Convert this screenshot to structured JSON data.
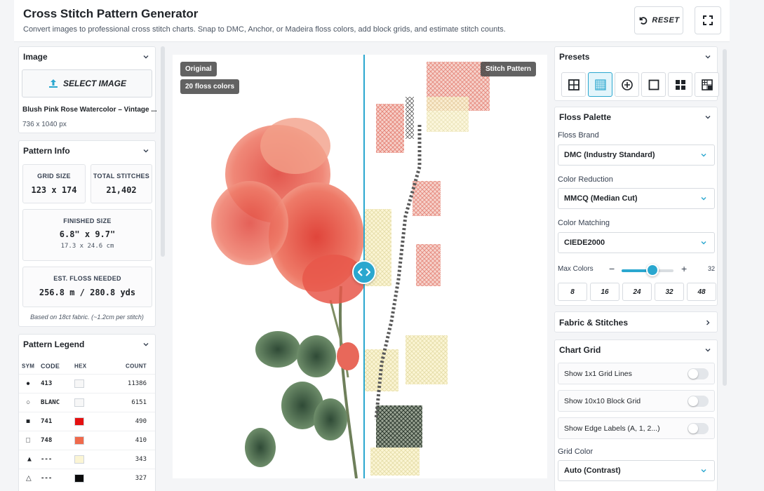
{
  "header": {
    "title": "Cross Stitch Pattern Generator",
    "subtitle": "Convert images to professional cross stitch charts. Snap to DMC, Anchor, or Madeira floss colors, add block grids, and estimate stitch counts.",
    "reset_label": "RESET",
    "fullscreen_icon": "expand-icon"
  },
  "image_panel": {
    "title": "Image",
    "select_label": "SELECT IMAGE",
    "file_name": "Blush Pink Rose Watercolor – Vintage ...",
    "dimensions": "736 x 1040 px"
  },
  "pattern_info": {
    "title": "Pattern Info",
    "grid_size_label": "GRID SIZE",
    "grid_size_value": "123 x 174",
    "total_stitches_label": "TOTAL STITCHES",
    "total_stitches_value": "21,402",
    "finished_size_label": "FINISHED SIZE",
    "finished_size_value": "6.8\" x 9.7\"",
    "finished_size_metric": "17.3 x 24.6 cm",
    "floss_label": "EST. FLOSS NEEDED",
    "floss_value": "256.8 m / 280.8 yds",
    "note": "Based on 18ct fabric. (~1.2cm per stitch)"
  },
  "legend": {
    "title": "Pattern Legend",
    "headers": {
      "sym": "SYM",
      "code": "CODE",
      "hex": "HEX",
      "count": "COUNT"
    },
    "rows": [
      {
        "sym": "●",
        "code": "413",
        "color": "#f7f7f7",
        "count": "11386"
      },
      {
        "sym": "○",
        "code": "BLANC",
        "color": "#f7f7f7",
        "count": "6151"
      },
      {
        "sym": "■",
        "code": "741",
        "color": "#e51010",
        "count": "490"
      },
      {
        "sym": "□",
        "code": "748",
        "color": "#ef6a4c",
        "count": "410"
      },
      {
        "sym": "▲",
        "code": "---",
        "color": "#fbf5d4",
        "count": "343"
      },
      {
        "sym": "△",
        "code": "---",
        "color": "#0b0b0b",
        "count": "327"
      }
    ]
  },
  "preview": {
    "original_label": "Original",
    "colors_badge": "20 floss colors",
    "pattern_label": "Stitch Pattern"
  },
  "presets": {
    "title": "Presets",
    "icons": [
      "grid-2x2-icon",
      "grid-fine-icon",
      "target-icon",
      "square-outline-icon",
      "grid-solid-icon",
      "grid-mixed-icon"
    ],
    "active_index": 1
  },
  "floss_palette": {
    "title": "Floss Palette",
    "brand_label": "Floss Brand",
    "brand_value": "DMC (Industry Standard)",
    "reduction_label": "Color Reduction",
    "reduction_value": "MMCQ (Median Cut)",
    "matching_label": "Color Matching",
    "matching_value": "CIEDE2000",
    "max_colors_label": "Max Colors",
    "minus": "−",
    "plus": "+",
    "max_colors_value": "32",
    "max_colors_range": [
      8,
      48
    ],
    "quick_values": [
      "8",
      "16",
      "24",
      "32",
      "48"
    ]
  },
  "fabric": {
    "title": "Fabric & Stitches"
  },
  "chart_grid": {
    "title": "Chart Grid",
    "toggles": [
      {
        "label": "Show 1x1 Grid Lines",
        "on": false
      },
      {
        "label": "Show 10x10 Block Grid",
        "on": false
      },
      {
        "label": "Show Edge Labels (A, 1, 2...)",
        "on": false
      }
    ],
    "grid_color_label": "Grid Color",
    "grid_color_value": "Auto (Contrast)"
  },
  "colors": {
    "accent": "#2aa7cf"
  }
}
